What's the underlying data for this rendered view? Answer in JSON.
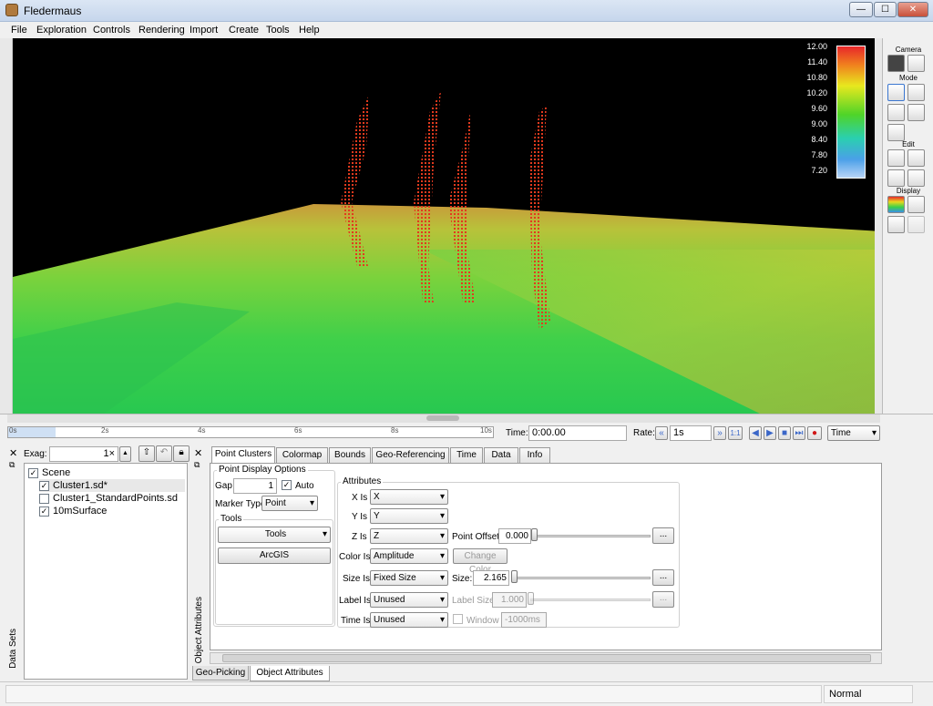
{
  "window": {
    "title": "Fledermaus",
    "minimize": "—",
    "maximize": "☐",
    "close": "✕"
  },
  "menu": [
    "File",
    "Exploration",
    "Controls",
    "Rendering",
    "Import",
    "Create",
    "Tools",
    "Help"
  ],
  "legend": {
    "ticks": [
      "12.00",
      "11.40",
      "10.80",
      "10.20",
      "9.60",
      "9.00",
      "8.40",
      "7.80",
      "7.20"
    ]
  },
  "tool_panel": {
    "camera": "Camera",
    "mode": "Mode",
    "edit": "Edit",
    "display": "Display"
  },
  "timeline": {
    "ticks": [
      "0s",
      "2s",
      "4s",
      "6s",
      "8s",
      "10s"
    ],
    "time_label": "Time:",
    "time_value": "0:00.00",
    "rate_label": "Rate:",
    "rate_value": "1s",
    "rate_mult": "1:1",
    "mode_select": "Time"
  },
  "datasets": {
    "exag_label": "Exag:",
    "exag_value": "1×",
    "dock_title": "Data Sets",
    "items": [
      {
        "label": "Scene",
        "checked": true
      },
      {
        "label": "Cluster1.sd*",
        "checked": true
      },
      {
        "label": "Cluster1_StandardPoints.sd",
        "checked": false
      },
      {
        "label": "10mSurface",
        "checked": true
      }
    ]
  },
  "object_attributes": {
    "dock_title": "Object Attributes",
    "tabs": [
      "Point Clusters",
      "Colormap",
      "Bounds",
      "Geo-Referencing",
      "Time",
      "Data",
      "Info"
    ],
    "point_display": {
      "group_title": "Point Display Options",
      "gap_label": "Gap",
      "gap_value": "1",
      "auto_label": "Auto",
      "marker_label": "Marker Type",
      "marker_value": "Point",
      "tools_title": "Tools",
      "tools_button": "Tools",
      "arcgis_button": "ArcGIS"
    },
    "attributes": {
      "group_title": "Attributes",
      "x_label": "X Is",
      "x_value": "X",
      "y_label": "Y Is",
      "y_value": "Y",
      "z_label": "Z Is",
      "z_value": "Z",
      "point_offset_label": "Point Offset",
      "point_offset_value": "0.000",
      "color_label": "Color Is",
      "color_value": "Amplitude",
      "change_color": "Change Color",
      "size_label": "Size Is",
      "size_value": "Fixed Size",
      "size_field_label": "Size:",
      "size_field_value": "2.165",
      "label_is_label": "Label Is",
      "label_is_value": "Unused",
      "label_size_label": "Label Size",
      "label_size_value": "1.000",
      "time_is_label": "Time Is",
      "time_is_value": "Unused",
      "window_label": "Window",
      "window_value": "-1000ms",
      "ellipsis": "..."
    }
  },
  "bottom_tabs": [
    "Geo-Picking",
    "Object Attributes"
  ],
  "status": {
    "mode": "Normal"
  }
}
